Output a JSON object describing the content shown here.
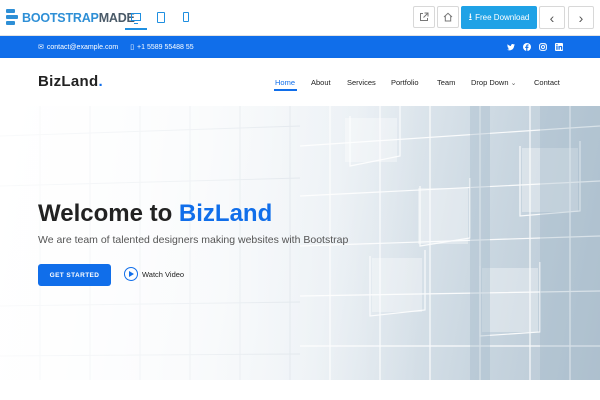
{
  "preview_bar": {
    "logo": {
      "part1": "BOOTSTRAP",
      "part2": "MADE"
    },
    "devices": [
      {
        "name": "desktop-view-icon",
        "active": true
      },
      {
        "name": "tablet-view-icon",
        "active": false
      },
      {
        "name": "mobile-view-icon",
        "active": false
      }
    ],
    "external_icon": "external-link-icon",
    "home_icon": "home-icon",
    "download_label": "Free Download",
    "prev_icon": "chevron-left-icon",
    "next_icon": "chevron-right-icon"
  },
  "topbar": {
    "email": "contact@example.com",
    "phone": "+1 5589 55488 55",
    "social": [
      "twitter-icon",
      "facebook-icon",
      "instagram-icon",
      "linkedin-icon"
    ]
  },
  "header": {
    "logo": {
      "text": "BizLand",
      "dot": "."
    },
    "menu": [
      {
        "label": "Home",
        "active": true
      },
      {
        "label": "About"
      },
      {
        "label": "Services"
      },
      {
        "label": "Portfolio"
      },
      {
        "label": "Team"
      },
      {
        "label": "Drop Down",
        "chevron": "⌄"
      },
      {
        "label": "Contact"
      }
    ]
  },
  "hero": {
    "title_prefix": "Welcome to ",
    "title_brand": "BizLand",
    "subtitle": "We are team of talented designers making websites with Bootstrap",
    "cta_label": "GET STARTED",
    "watch_label": "Watch Video"
  },
  "colors": {
    "primary": "#106eea",
    "download_button": "#1fa2e6",
    "logo_blue": "#2e8fd6"
  }
}
